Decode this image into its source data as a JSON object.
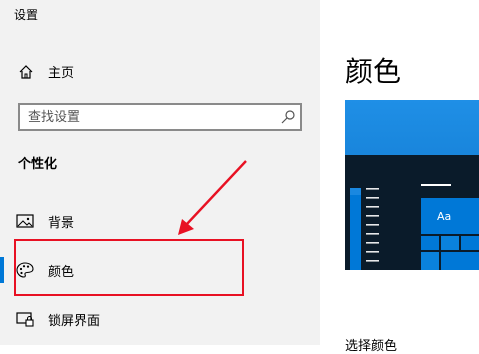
{
  "app": {
    "title": "设置"
  },
  "sidebar": {
    "home_label": "主页",
    "search": {
      "placeholder": "查找设置",
      "icon": "search-icon"
    },
    "section_heading": "个性化",
    "items": [
      {
        "label": "背景",
        "icon": "image-icon"
      },
      {
        "label": "颜色",
        "icon": "palette-icon",
        "selected": true
      },
      {
        "label": "锁屏界面",
        "icon": "lock-screen-icon"
      }
    ]
  },
  "main": {
    "title": "颜色",
    "preview_tile_label": "Aa",
    "section_heading_partial": "选择颜色"
  },
  "colors": {
    "accent": "#0078d7",
    "sidebar_bg": "#f2f2f2",
    "highlight": "#e81123",
    "preview_dark": "#0a1b2a"
  }
}
